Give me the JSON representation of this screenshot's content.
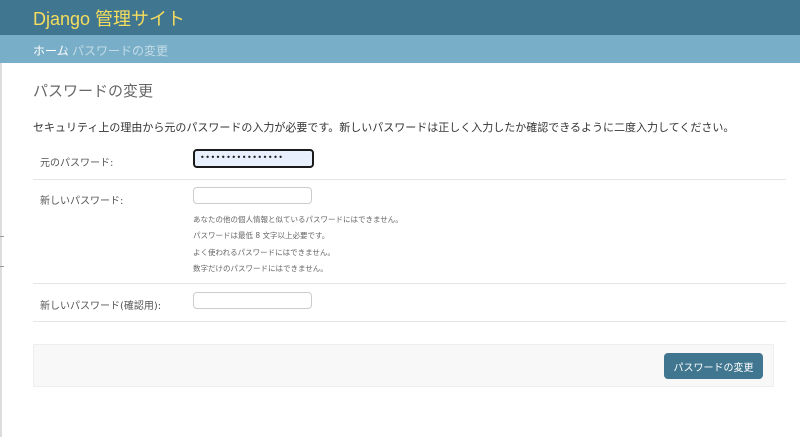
{
  "header": {
    "brand": "Django 管理サイト"
  },
  "breadcrumb": {
    "home": "ホーム",
    "separator": "›",
    "current": "パスワードの変更"
  },
  "page": {
    "title": "パスワードの変更",
    "intro": "セキュリティ上の理由から元のパスワードの入力が必要です。新しいパスワードは正しく入力したか確認できるように二度入力してください。"
  },
  "form": {
    "old_password": {
      "label": "元のパスワード:",
      "value": "••••••••••••••••"
    },
    "new_password1": {
      "label": "新しいパスワード:",
      "value": "",
      "help": [
        "あなたの他の個人情報と似ているパスワードにはできません。",
        "パスワードは最低 8 文字以上必要です。",
        "よく使われるパスワードにはできません。",
        "数字だけのパスワードにはできません。"
      ]
    },
    "new_password2": {
      "label": "新しいパスワード(確認用):",
      "value": ""
    }
  },
  "submit": {
    "label": "パスワードの変更"
  },
  "colors": {
    "header_bg": "#417690",
    "brand_text": "#f5dd5d",
    "breadcrumb_bg": "#79aec8",
    "button_bg": "#417690"
  }
}
